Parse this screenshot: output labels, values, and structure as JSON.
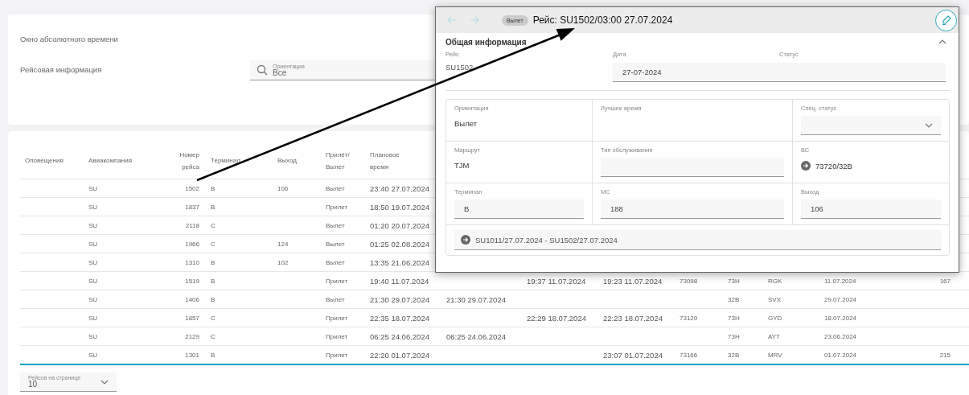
{
  "top_panel": {
    "absolute_time_label": "Окно абсолютного времени",
    "flight_info_label": "Рейсовая информация",
    "orientation_filter": {
      "label": "Ориентация",
      "value": "Все"
    }
  },
  "table": {
    "columns": [
      {
        "label": "Оповещения"
      },
      {
        "label": "Авиакомпания"
      },
      {
        "label": "Номер рейса"
      },
      {
        "label": "Терминал"
      },
      {
        "label": "Выход"
      },
      {
        "label": "Прилёт/ Вылет"
      },
      {
        "label": "Плановое время"
      }
    ],
    "rows": [
      {
        "airline": "SU",
        "number": "1502",
        "terminal": "B",
        "gate": "106",
        "direction": "Вылет",
        "planned": "23:40 27.07.2024"
      },
      {
        "airline": "SU",
        "number": "1837",
        "terminal": "B",
        "direction": "Прилет",
        "planned": "18:50 19.07.2024"
      },
      {
        "airline": "SU",
        "number": "2118",
        "terminal": "C",
        "direction": "Вылет",
        "planned": "01:20 20.07.2024"
      },
      {
        "airline": "SU",
        "number": "1966",
        "terminal": "C",
        "gate": "124",
        "direction": "Вылет",
        "planned": "01:25 02.08.2024"
      },
      {
        "airline": "SU",
        "number": "1310",
        "terminal": "B",
        "gate": "102",
        "direction": "Вылет",
        "planned": "13:35 21.06.2024"
      },
      {
        "airline": "SU",
        "number": "1519",
        "terminal": "B",
        "direction": "Прилет",
        "planned": "19:40 11.07.2024",
        "column_9": "19:37 11.07.2024",
        "column_10": "19:23 11.07.2024",
        "column_11": "73098",
        "column_12": "73H",
        "column_13": "RGK",
        "column_14": "11.07.2024",
        "column_15": "167"
      },
      {
        "airline": "SU",
        "number": "1406",
        "terminal": "B",
        "direction": "Вылет",
        "planned": "21:30 29.07.2024",
        "column_8": "21:30 29.07.2024",
        "column_12": "32B",
        "column_13": "SVX",
        "column_14": "29.07.2024"
      },
      {
        "airline": "SU",
        "number": "1857",
        "terminal": "C",
        "direction": "Прилет",
        "planned": "22:35 18.07.2024",
        "column_9": "22:29 18.07.2024",
        "column_10": "22:23 18.07.2024",
        "column_11": "73120",
        "column_12": "73H",
        "column_13": "GYD",
        "column_14": "18.07.2024"
      },
      {
        "airline": "SU",
        "number": "2129",
        "terminal": "C",
        "direction": "Прилет",
        "planned": "06:25 24.06.2024",
        "column_8": "06:25 24.06.2024",
        "column_12": "73H",
        "column_13": "AYT",
        "column_14": "23.06.2024"
      },
      {
        "airline": "SU",
        "number": "1301",
        "terminal": "B",
        "direction": "Прилет",
        "planned": "22:20 01.07.2024",
        "column_10": "23:07 01.07.2024",
        "column_11": "73166",
        "column_12": "32B",
        "column_13": "MRV",
        "column_14": "01.07.2024",
        "column_15": "215"
      }
    ]
  },
  "pagination": {
    "label": "Рейсов на странице",
    "value": "10"
  },
  "flight_card": {
    "nav": [
      {
        "kind": "back",
        "disabled": true
      },
      {
        "kind": "forward",
        "disabled": true
      }
    ],
    "direction_badge": "Вылет",
    "title": "Рейс: SU1502/03:00 27.07.2024",
    "section": {
      "title": "Общая информация",
      "expanded": true
    },
    "top_fields": [
      {
        "label": "Рейс",
        "kind": "text",
        "value": "SU1502"
      },
      {
        "label": "Дата",
        "kind": "input",
        "value": "27-07-2024"
      },
      {
        "label": "Статус",
        "kind": "input"
      }
    ],
    "grid": [
      {
        "label": "Ориентация",
        "kind": "text",
        "value": "Вылет"
      },
      {
        "label": "Лучшее время",
        "kind": "text"
      },
      {
        "label": "Спец. статус",
        "kind": "select"
      },
      {
        "label": "Маршрут",
        "kind": "text",
        "value": "TJM"
      },
      {
        "label": "Тип обслуживания",
        "kind": "input"
      },
      {
        "label": "ВС",
        "kind": "link",
        "value": "73720/32B"
      },
      {
        "label": "Терминал",
        "kind": "input",
        "value": "B"
      },
      {
        "label": "МС",
        "kind": "input",
        "value": "188"
      },
      {
        "label": "Выход",
        "kind": "input",
        "value": "106"
      }
    ],
    "connection": {
      "value": "SU1011/27.07.2024 - SU1502/27.07.2024"
    }
  }
}
